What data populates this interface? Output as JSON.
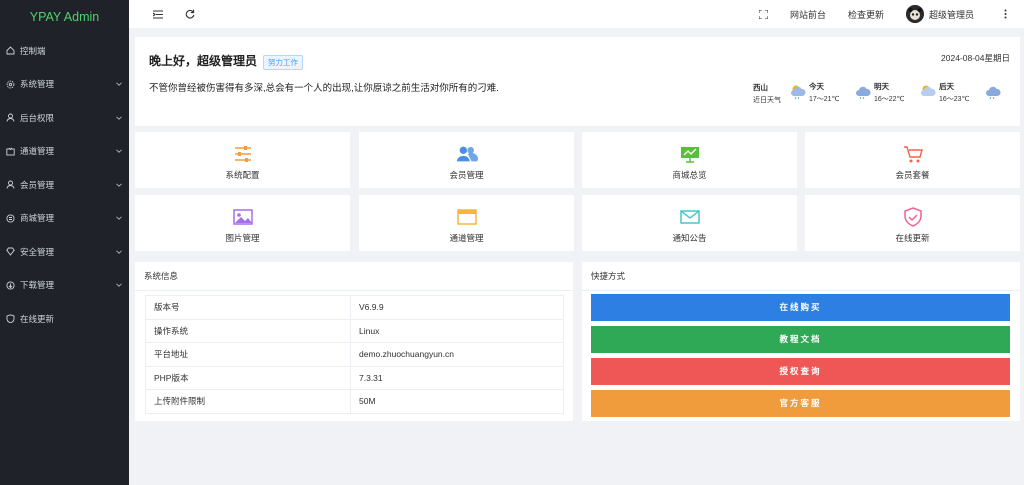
{
  "app": {
    "title": "YPAY Admin"
  },
  "sidebar": {
    "items": [
      {
        "label": "控制端",
        "icon": "home-icon",
        "has_children": false
      },
      {
        "label": "系统管理",
        "icon": "settings-icon",
        "has_children": true
      },
      {
        "label": "后台权限",
        "icon": "user-icon",
        "has_children": true
      },
      {
        "label": "通道管理",
        "icon": "channel-icon",
        "has_children": true
      },
      {
        "label": "会员管理",
        "icon": "user-icon",
        "has_children": true
      },
      {
        "label": "商城管理",
        "icon": "shop-icon",
        "has_children": true
      },
      {
        "label": "安全管理",
        "icon": "diamond-icon",
        "has_children": true
      },
      {
        "label": "下载管理",
        "icon": "download-icon",
        "has_children": true
      },
      {
        "label": "在线更新",
        "icon": "shield-icon",
        "has_children": false
      }
    ]
  },
  "topbar": {
    "site_front": "网站前台",
    "check_update": "检查更新",
    "username": "超级管理员"
  },
  "greeting": {
    "title": "晚上好，超级管理员",
    "badge": "努力工作",
    "quote": "不管你曾经被伤害得有多深,总会有一个人的出现,让你原谅之前生活对你所有的刁难.",
    "date": "2024-08-04星期日"
  },
  "weather": {
    "location": "西山",
    "subtitle": "近日天气",
    "days": [
      {
        "label": "今天",
        "temp": "17～21℃"
      },
      {
        "label": "明天",
        "temp": "16～22℃"
      },
      {
        "label": "后天",
        "temp": "16～23℃"
      }
    ]
  },
  "tiles": [
    {
      "label": "系统配置",
      "icon": "sliders-icon",
      "color": "#f39c3c"
    },
    {
      "label": "会员管理",
      "icon": "users-icon",
      "color": "#4a90e2"
    },
    {
      "label": "商城总览",
      "icon": "chart-board-icon",
      "color": "#5bbd3c"
    },
    {
      "label": "会员套餐",
      "icon": "cart-icon",
      "color": "#f0644a"
    },
    {
      "label": "图片管理",
      "icon": "image-icon",
      "color": "#a66ee8"
    },
    {
      "label": "通道管理",
      "icon": "window-icon",
      "color": "#f5b63c"
    },
    {
      "label": "通知公告",
      "icon": "mail-icon",
      "color": "#3cc4c4"
    },
    {
      "label": "在线更新",
      "icon": "shield-check-icon",
      "color": "#f06292"
    }
  ],
  "system_info": {
    "title": "系统信息",
    "rows": [
      {
        "key": "版本号",
        "value": "V6.9.9"
      },
      {
        "key": "操作系统",
        "value": "Linux"
      },
      {
        "key": "平台地址",
        "value": "demo.zhuochuangyun.cn"
      },
      {
        "key": "PHP版本",
        "value": "7.3.31"
      },
      {
        "key": "上传附件限制",
        "value": "50M"
      }
    ]
  },
  "shortcuts": {
    "title": "快捷方式",
    "buttons": [
      {
        "label": "在线购买",
        "color": "#2d7fe3"
      },
      {
        "label": "教程文档",
        "color": "#2fa955"
      },
      {
        "label": "授权查询",
        "color": "#ef5756"
      },
      {
        "label": "官方客服",
        "color": "#f09b3c"
      }
    ]
  }
}
